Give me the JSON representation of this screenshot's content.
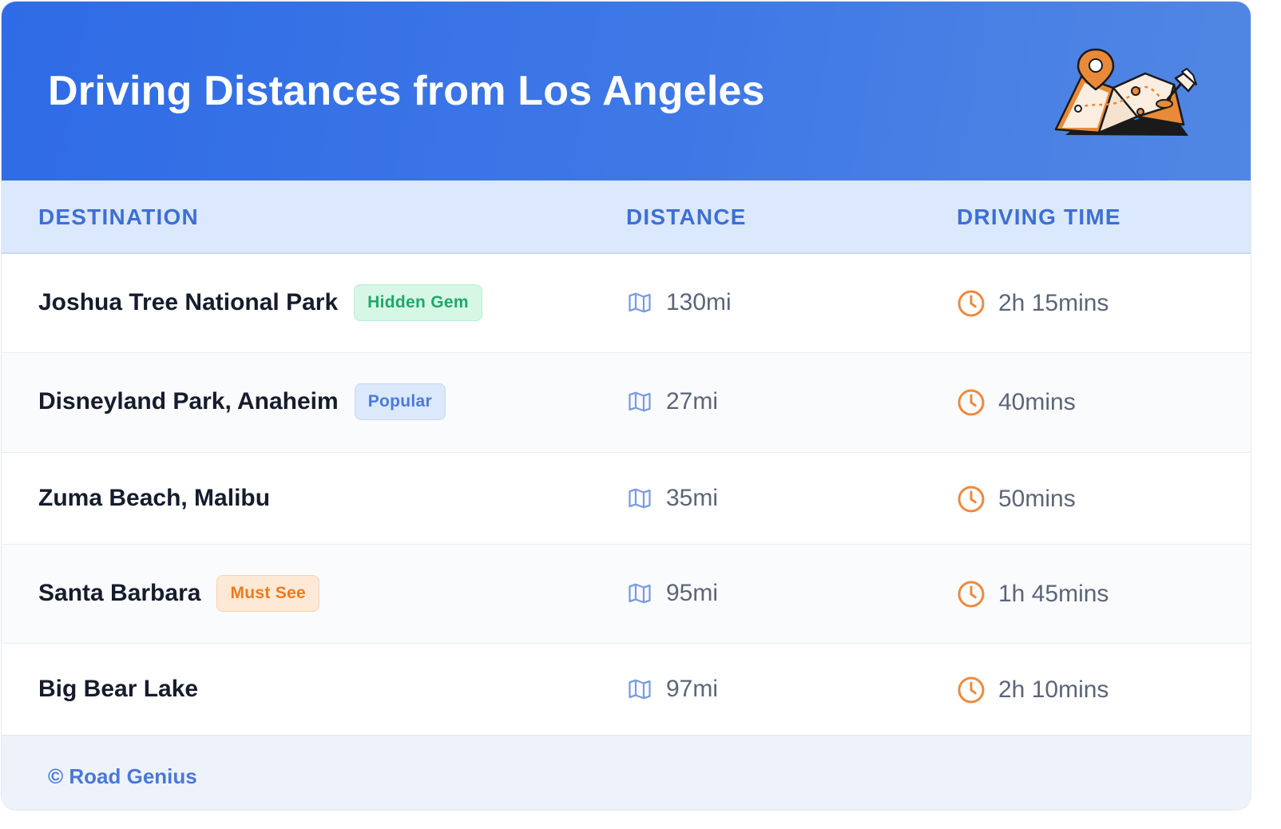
{
  "header": {
    "title": "Driving Distances from Los Angeles",
    "illustration_icon": "folded-map-with-pins-icon"
  },
  "table": {
    "columns": [
      "DESTINATION",
      "DISTANCE",
      "DRIVING TIME"
    ],
    "rows": [
      {
        "destination": "Joshua Tree National Park",
        "badge": "Hidden Gem",
        "badge_color": "#1ea86a",
        "distance": "130mi",
        "time": "2h 15mins"
      },
      {
        "destination": "Disneyland Park, Anaheim",
        "badge": "Popular",
        "badge_color": "#4a7bd8",
        "distance": "27mi",
        "time": "40mins"
      },
      {
        "destination": "Zuma Beach, Malibu",
        "badge": "",
        "distance": "35mi",
        "time": "50mins"
      },
      {
        "destination": "Santa Barbara",
        "badge": "Must See",
        "badge_color": "#ee7a1c",
        "distance": "95mi",
        "time": "1h 45mins"
      },
      {
        "destination": "Big Bear Lake",
        "badge": "",
        "distance": "97mi",
        "time": "2h 10mins"
      }
    ],
    "distance_icon": "map-icon",
    "time_icon": "clock-icon"
  },
  "footer": {
    "text": "© Road Genius"
  },
  "colors": {
    "header_blue": "#2f6be6",
    "accent_orange": "#ec8a3f",
    "column_header_text": "#3d6fd6"
  }
}
